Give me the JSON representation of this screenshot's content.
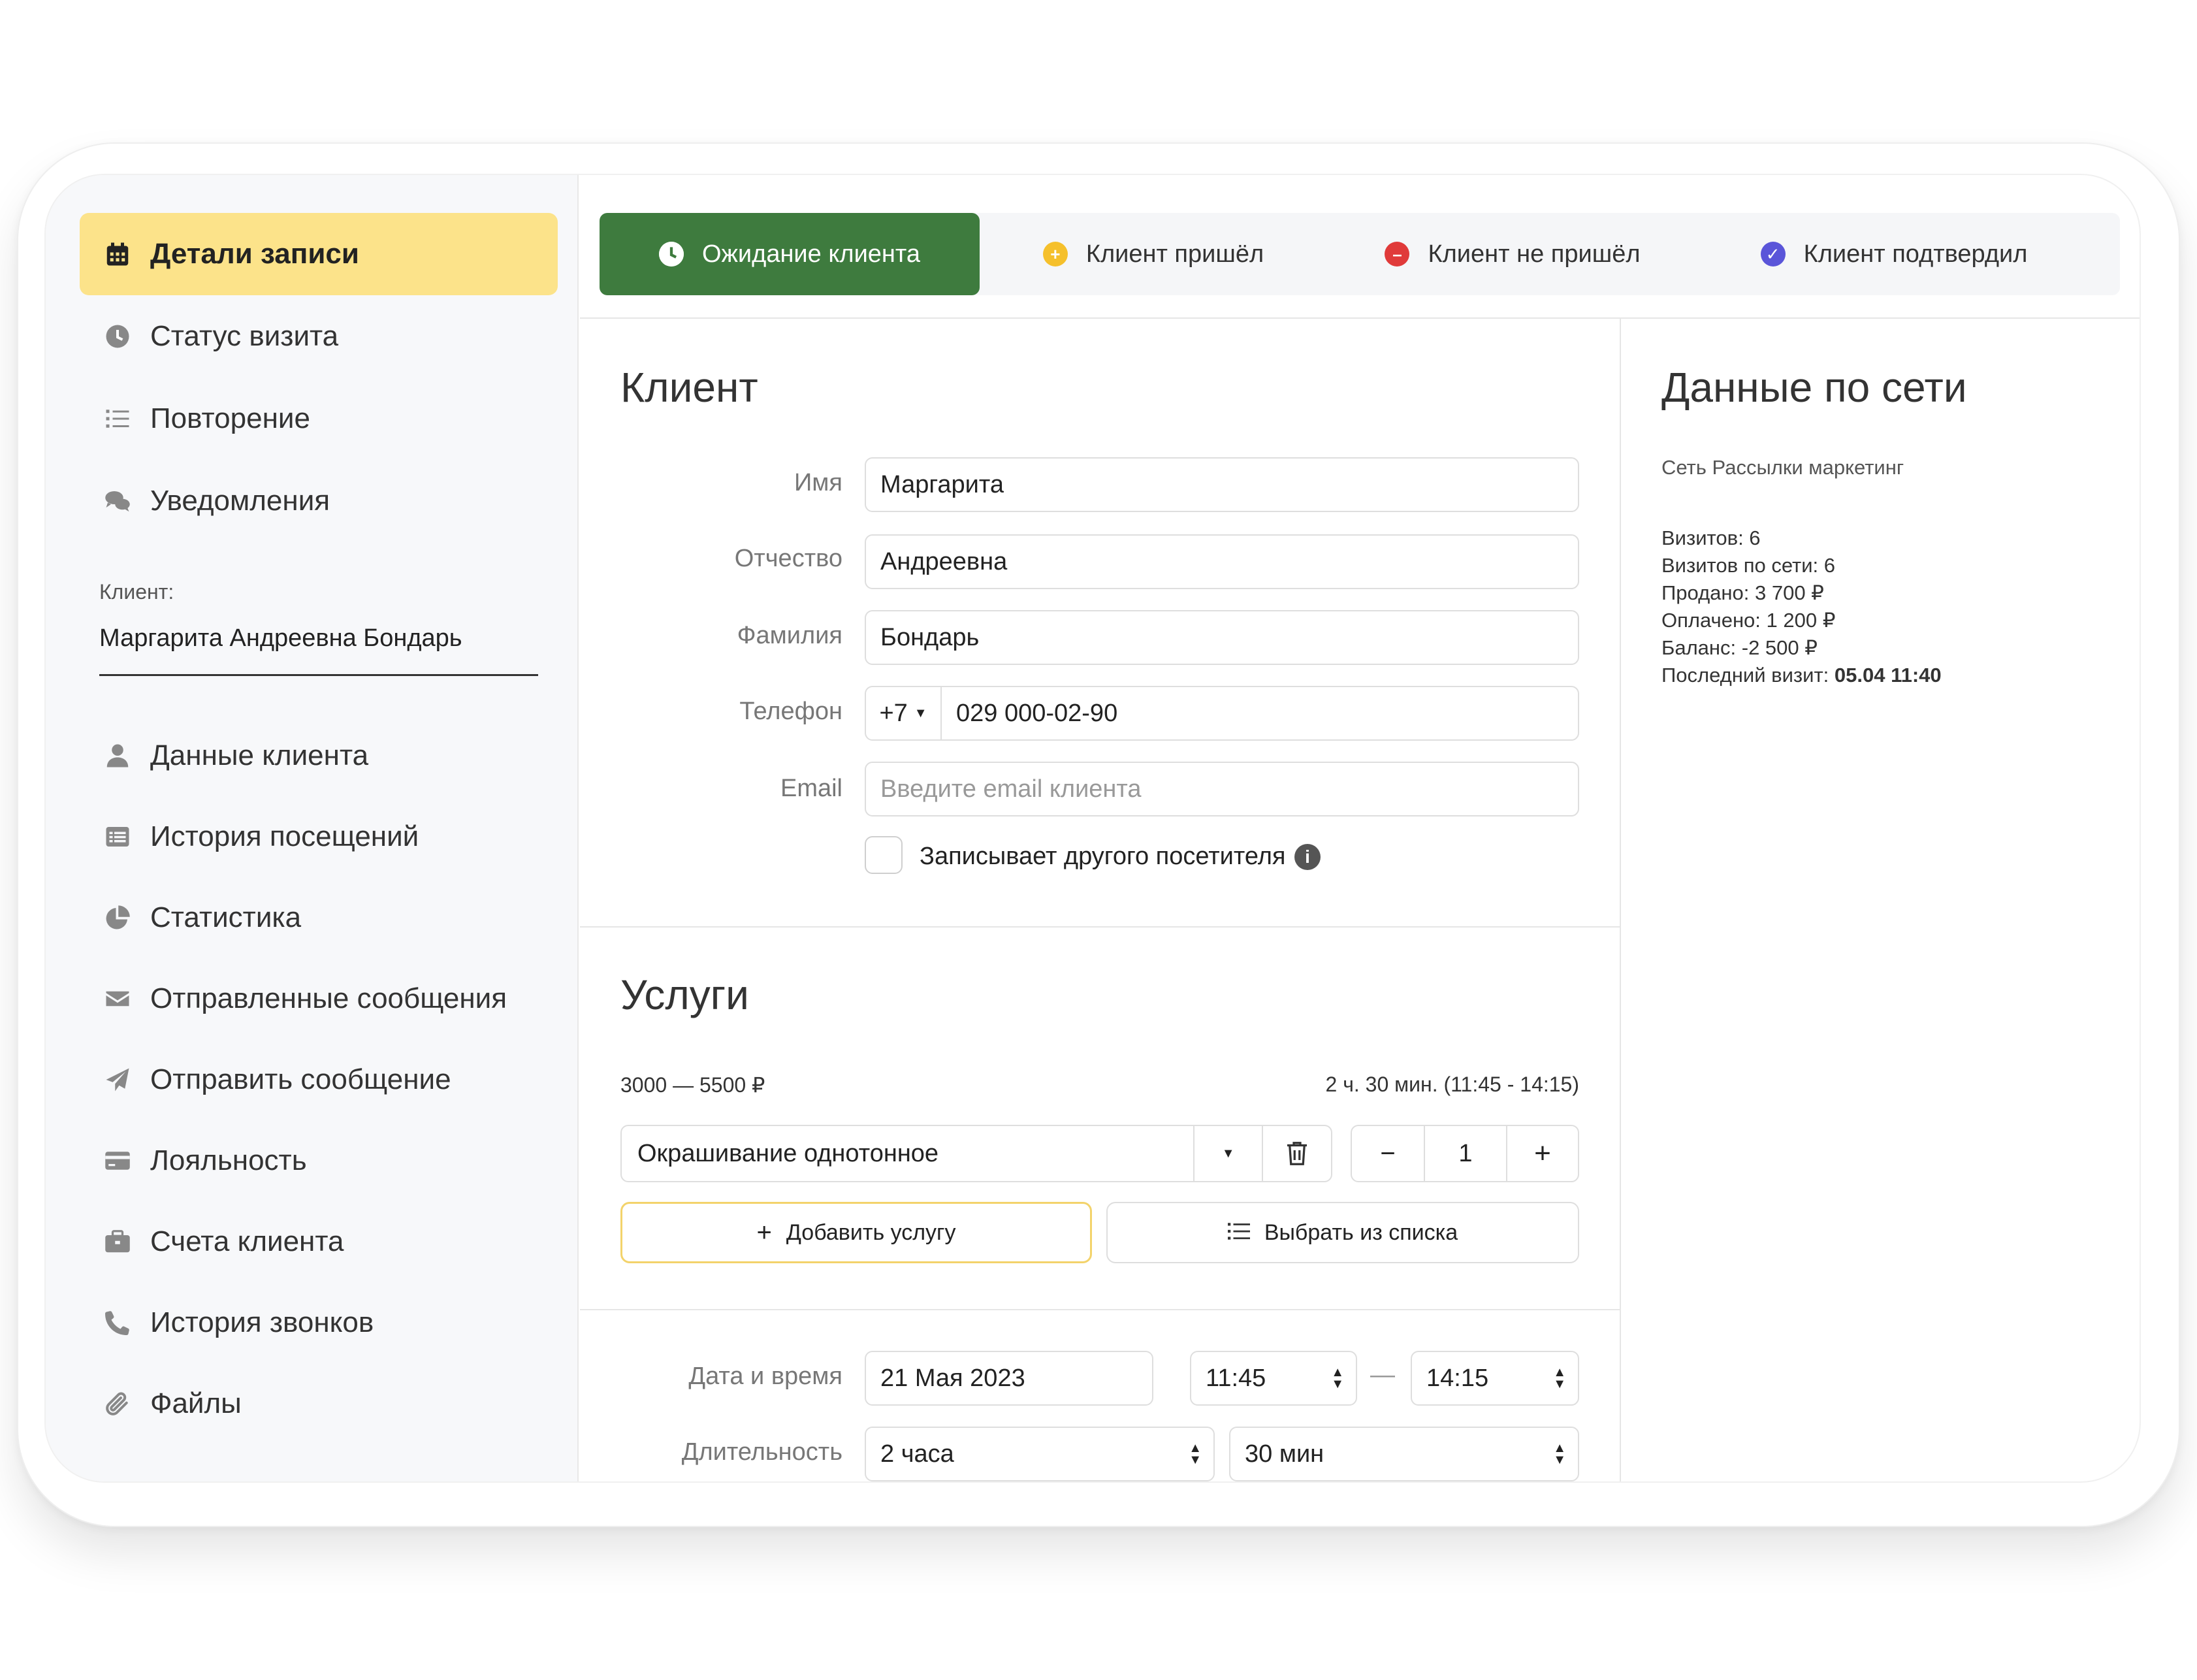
{
  "sidebar": {
    "items_top": [
      {
        "label": "Детали записи",
        "icon": "calendar-icon"
      },
      {
        "label": "Статус визита",
        "icon": "clock-icon"
      },
      {
        "label": "Повторение",
        "icon": "list-icon"
      },
      {
        "label": "Уведомления",
        "icon": "chat-icon"
      }
    ],
    "client_label": "Клиент:",
    "client_name": "Маргарита  Андреевна Бондарь",
    "items_bottom": [
      {
        "label": "Данные клиента",
        "icon": "user-icon"
      },
      {
        "label": "История посещений",
        "icon": "history-icon"
      },
      {
        "label": "Статистика",
        "icon": "pie-chart-icon"
      },
      {
        "label": "Отправленные сообщения",
        "icon": "envelope-icon"
      },
      {
        "label": "Отправить сообщение",
        "icon": "paper-plane-icon"
      },
      {
        "label": "Лояльность",
        "icon": "card-icon"
      },
      {
        "label": "Счета клиента",
        "icon": "briefcase-icon"
      },
      {
        "label": "История звонков",
        "icon": "phone-icon"
      },
      {
        "label": "Файлы",
        "icon": "paperclip-icon"
      }
    ]
  },
  "status_tabs": [
    {
      "label": "Ожидание клиента",
      "color": "#3e7b3e"
    },
    {
      "label": "Клиент пришёл",
      "color": "#f5c02c"
    },
    {
      "label": "Клиент не пришёл",
      "color": "#e03a3a"
    },
    {
      "label": "Клиент подтвердил",
      "color": "#5a55d9"
    }
  ],
  "client": {
    "title": "Клиент",
    "name_label": "Имя",
    "name": "Маргарита",
    "patronymic_label": "Отчество",
    "patronymic": "Андреевна",
    "surname_label": "Фамилия",
    "surname": "Бондарь",
    "phone_label": "Телефон",
    "phone_code": "+7",
    "phone": "029 000-02-90",
    "email_label": "Email",
    "email_placeholder": "Введите email клиента",
    "other_visitor_label": "Записывает другого посетителя"
  },
  "services": {
    "title": "Услуги",
    "price_range": "3000 — 5500 ₽",
    "duration_summary": "2 ч. 30 мин. (11:45 - 14:15)",
    "service_name": "Окрашивание однотонное",
    "quantity": "1",
    "add_label": "Добавить услугу",
    "choose_label": "Выбрать из списка"
  },
  "schedule": {
    "datetime_label": "Дата и время",
    "date": "21 Мая 2023",
    "start": "11:45",
    "dash": "—",
    "end": "14:15",
    "duration_label": "Длительность",
    "hours": "2 часа",
    "minutes": "30 мин"
  },
  "network": {
    "title": "Данные по сети",
    "subtitle": "Сеть Рассылки маркетинг",
    "visits": "Визитов: 6",
    "network_visits": "Визитов по сети: 6",
    "sold": "Продано: 3 700 ₽",
    "paid": "Оплачено: 1 200 ₽",
    "balance": "Баланс: -2 500 ₽",
    "last_visit_label": "Последний визит: ",
    "last_visit_value": "05.04 11:40"
  }
}
